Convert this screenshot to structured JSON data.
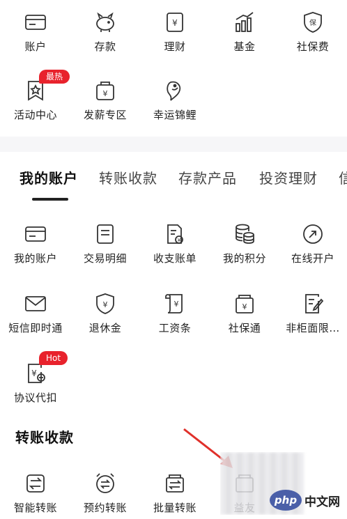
{
  "top_grid": [
    {
      "label": "账户",
      "icon": "card-icon"
    },
    {
      "label": "存款",
      "icon": "piggy-bank-icon"
    },
    {
      "label": "理财",
      "icon": "yen-box-icon"
    },
    {
      "label": "基金",
      "icon": "bar-growth-icon"
    },
    {
      "label": "社保费",
      "icon": "shield-bao-icon"
    },
    {
      "label": "活动中心",
      "icon": "star-flag-icon",
      "badge": "最热"
    },
    {
      "label": "发薪专区",
      "icon": "yen-bag-icon"
    },
    {
      "label": "幸运锦鲤",
      "icon": "koi-fish-icon"
    }
  ],
  "tabs": [
    "我的账户",
    "转账收款",
    "存款产品",
    "投资理财",
    "信"
  ],
  "account_grid": [
    {
      "label": "我的账户",
      "icon": "card-icon"
    },
    {
      "label": "交易明细",
      "icon": "list-doc-icon"
    },
    {
      "label": "收支账单",
      "icon": "bill-icon"
    },
    {
      "label": "我的积分",
      "icon": "coins-icon"
    },
    {
      "label": "在线开户",
      "icon": "open-account-icon"
    },
    {
      "label": "短信即时通",
      "icon": "mail-icon"
    },
    {
      "label": "退休金",
      "icon": "yen-shield-icon"
    },
    {
      "label": "工资条",
      "icon": "scroll-yen-icon"
    },
    {
      "label": "社保通",
      "icon": "yen-box-icon"
    },
    {
      "label": "非柜面限…",
      "icon": "edit-doc-icon"
    },
    {
      "label": "协议代扣",
      "icon": "yen-minus-icon",
      "badge": "Hot"
    }
  ],
  "transfer_section": {
    "title": "转账收款",
    "items": [
      {
        "label": "智能转账",
        "icon": "transfer-icon"
      },
      {
        "label": "预约转账",
        "icon": "alarm-transfer-icon"
      },
      {
        "label": "批量转账",
        "icon": "batch-transfer-icon"
      },
      {
        "label": "益友",
        "icon": "wallet-icon"
      }
    ]
  },
  "watermark": {
    "logo": "php",
    "text": "中文网"
  },
  "colors": {
    "badge": "#e8222c",
    "text": "#222222",
    "band": "#f6f6f8"
  }
}
